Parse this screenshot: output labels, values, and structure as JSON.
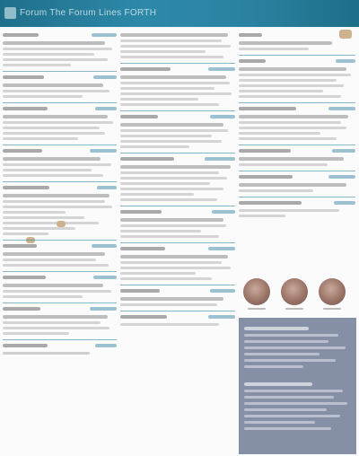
{
  "banner": {
    "title": "Forum The Forum Lines FORTH"
  },
  "columns": [
    {
      "id": "left"
    },
    {
      "id": "middle"
    },
    {
      "id": "right"
    }
  ],
  "people": [
    {
      "name": ""
    },
    {
      "name": ""
    },
    {
      "name": ""
    }
  ],
  "colors": {
    "banner": "#2a82a0",
    "rule": "#2d7f9e",
    "sidebar_box": "#8590a6",
    "background": "#fbfbfb"
  }
}
